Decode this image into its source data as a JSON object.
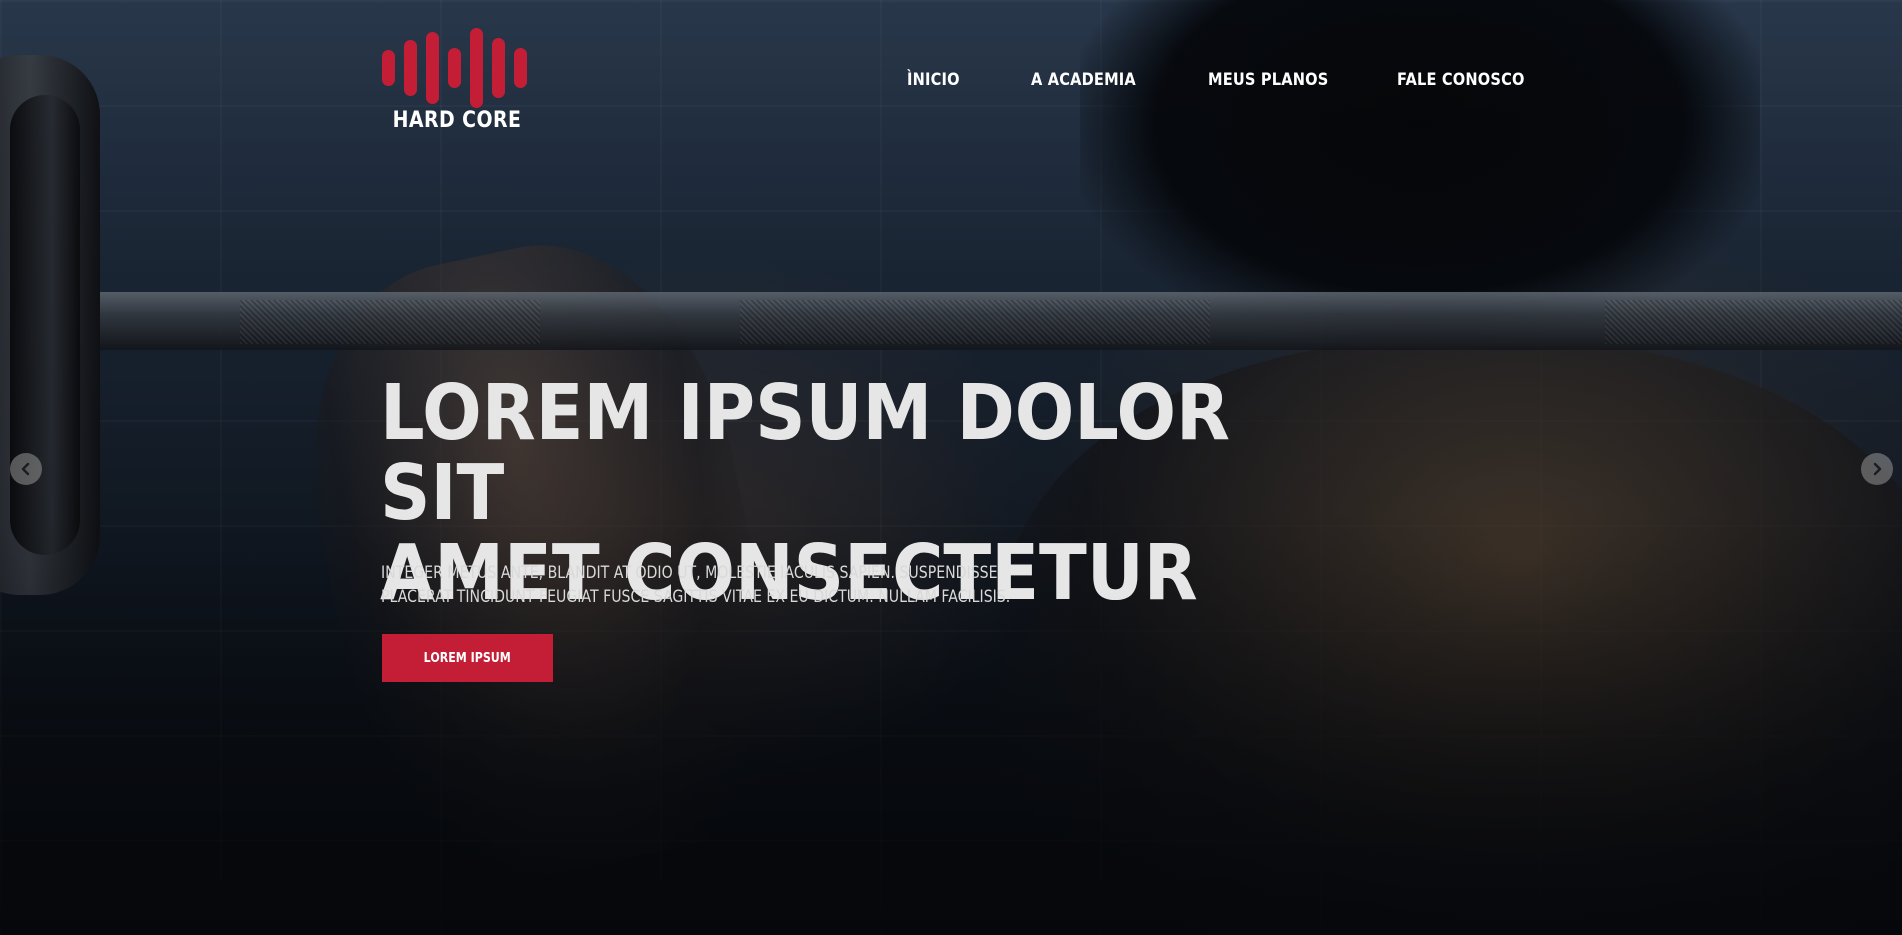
{
  "logo": {
    "text": "HARD CORE",
    "color": "#c41e36"
  },
  "nav": {
    "items": [
      {
        "label": "ÌNICIO"
      },
      {
        "label": "A ACADEMIA"
      },
      {
        "label": "MEUS PLANOS"
      },
      {
        "label": "FALE CONOSCO"
      }
    ]
  },
  "hero": {
    "headline_line1": "LOREM IPSUM DOLOR SIT",
    "headline_line2": "AMET CONSECTETUR",
    "subtitle_line1": "INTEGER METUS ANTE, BLANDIT AT ODIO UT, MOLESTIE IACULIS SAPIEN. SUSPENDISSE",
    "subtitle_line2": "PLACERAT TINCIDUNT FEUGIAT FUSCE SAGITTIS VITAE EX EU DICTUM. NULLAM FACILISIS.",
    "cta_label": "LOREM IPSUM",
    "accent_color": "#c41e36"
  },
  "carousel": {
    "prev_icon": "chevron-left-icon",
    "next_icon": "chevron-right-icon"
  }
}
